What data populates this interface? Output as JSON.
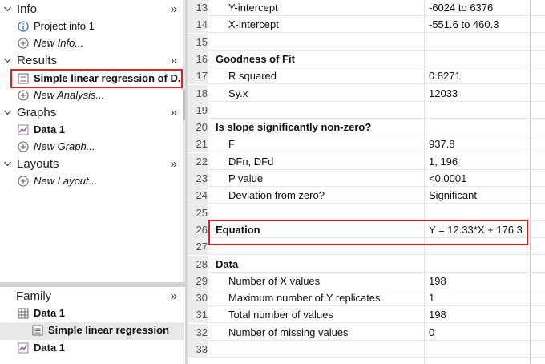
{
  "navigator": {
    "sections": [
      {
        "title": "Info",
        "expand": "»"
      },
      {
        "title": "Results",
        "expand": "»"
      },
      {
        "title": "Graphs",
        "expand": "»"
      },
      {
        "title": "Layouts",
        "expand": "»"
      }
    ],
    "info_items": [
      "Project info 1",
      "New Info..."
    ],
    "results_items": [
      "Simple linear regression of D...",
      "New Analysis..."
    ],
    "graphs_items": [
      "Data 1",
      "New Graph..."
    ],
    "layouts_items": [
      "New Layout..."
    ]
  },
  "family": {
    "title": "Family",
    "expand": "»",
    "items": [
      "Data 1",
      "Simple linear regression",
      "Data 1"
    ]
  },
  "sheet": {
    "rows": [
      {
        "n": "13",
        "label": "Y-intercept",
        "value": "-6024 to 6376"
      },
      {
        "n": "14",
        "label": "X-intercept",
        "value": "-551.6 to 460.3"
      },
      {
        "n": "15",
        "label": "",
        "value": ""
      },
      {
        "n": "16",
        "label": "Goodness of Fit",
        "value": ""
      },
      {
        "n": "17",
        "label": "R squared",
        "value": "0.8271"
      },
      {
        "n": "18",
        "label": "Sy.x",
        "value": "12033"
      },
      {
        "n": "19",
        "label": "",
        "value": ""
      },
      {
        "n": "20",
        "label": "Is slope significantly non-zero?",
        "value": ""
      },
      {
        "n": "21",
        "label": "F",
        "value": "937.8"
      },
      {
        "n": "22",
        "label": "DFn, DFd",
        "value": "1, 196"
      },
      {
        "n": "23",
        "label": "P value",
        "value": "<0.0001"
      },
      {
        "n": "24",
        "label": "Deviation from zero?",
        "value": "Significant"
      },
      {
        "n": "25",
        "label": "",
        "value": ""
      },
      {
        "n": "26",
        "label": "Equation",
        "value": "Y = 12.33*X + 176.3"
      },
      {
        "n": "27",
        "label": "",
        "value": ""
      },
      {
        "n": "28",
        "label": "Data",
        "value": ""
      },
      {
        "n": "29",
        "label": "Number of X values",
        "value": "198"
      },
      {
        "n": "30",
        "label": "Maximum number of Y replicates",
        "value": "1"
      },
      {
        "n": "31",
        "label": "Total number of values",
        "value": "198"
      },
      {
        "n": "32",
        "label": "Number of missing values",
        "value": "0"
      },
      {
        "n": "33",
        "label": "",
        "value": ""
      }
    ]
  },
  "colors": {
    "highlight_box": "#e02020",
    "info_icon": "#2b66c4",
    "graph_icon": "#9a3fa8"
  }
}
